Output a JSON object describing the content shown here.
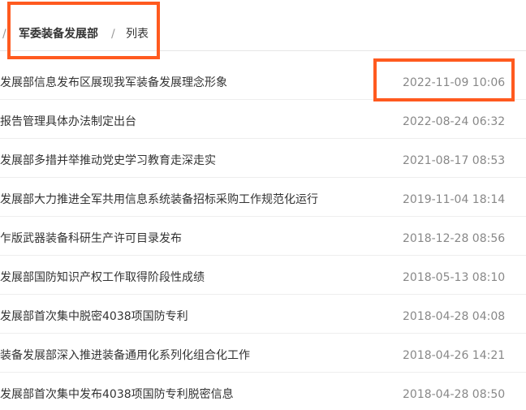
{
  "breadcrumb": {
    "lead_separator": "/",
    "current": "军委装备发展部",
    "separator": "/",
    "leaf": "列表"
  },
  "items": [
    {
      "title": "发展部信息发布区展现我军装备发展理念形象",
      "date": "2022-11-09 10:06"
    },
    {
      "title": "报告管理具体办法制定出台",
      "date": "2022-08-24 06:32"
    },
    {
      "title": "发展部多措并举推动党史学习教育走深走实",
      "date": "2021-08-17 08:53"
    },
    {
      "title": "发展部大力推进全军共用信息系统装备招标采购工作规范化运行",
      "date": "2019-11-04 18:14"
    },
    {
      "title": "乍版武器装备科研生产许可目录发布",
      "date": "2018-12-28 08:56"
    },
    {
      "title": "发展部国防知识产权工作取得阶段性成绩",
      "date": "2018-05-13 08:10"
    },
    {
      "title": "发展部首次集中脱密4038项国防专利",
      "date": "2018-04-28 04:08"
    },
    {
      "title": "装备发展部深入推进装备通用化系列化组合化工作",
      "date": "2018-04-26 14:21"
    },
    {
      "title": "发展部首次集中发布4038项国防专利脱密信息",
      "date": "2018-04-28 08:50"
    }
  ],
  "colors": {
    "highlight": "#ff5a1f",
    "title_text": "#333333",
    "date_text": "#888888"
  }
}
